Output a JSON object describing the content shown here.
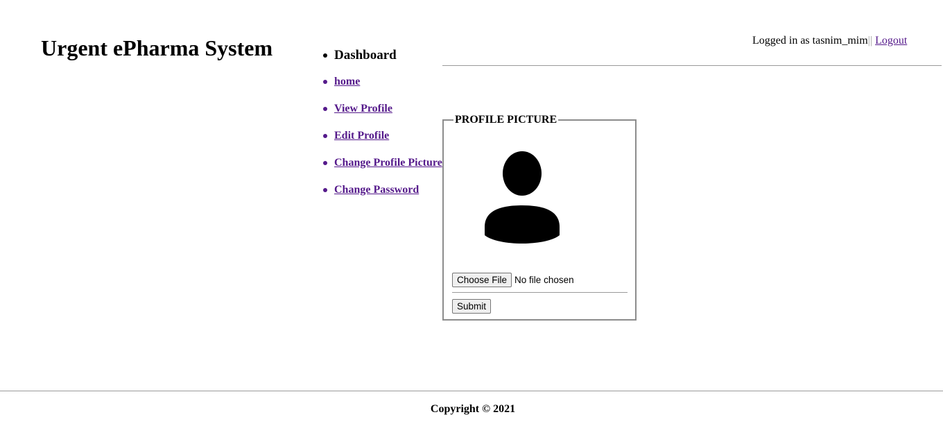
{
  "header": {
    "site_title": "Urgent ePharma System",
    "logged_in_prefix": "Logged in as tasnim_mim",
    "separator": "||",
    "logout_label": "Logout"
  },
  "nav": {
    "heading": "Dashboard",
    "items": [
      {
        "label": "home"
      },
      {
        "label": "View Profile"
      },
      {
        "label": "Edit Profile"
      },
      {
        "label": "Change Profile Picture"
      },
      {
        "label": "Change Password"
      }
    ]
  },
  "profile_picture": {
    "legend": "PROFILE PICTURE",
    "avatar_icon": "user-silhouette-icon",
    "choose_file_label": "Choose File",
    "file_status": "No file chosen",
    "submit_label": "Submit"
  },
  "footer": {
    "copyright": "Copyright © 2021"
  },
  "colors": {
    "link": "#551a8b",
    "rule": "#9a9a9a",
    "text": "#000000"
  }
}
